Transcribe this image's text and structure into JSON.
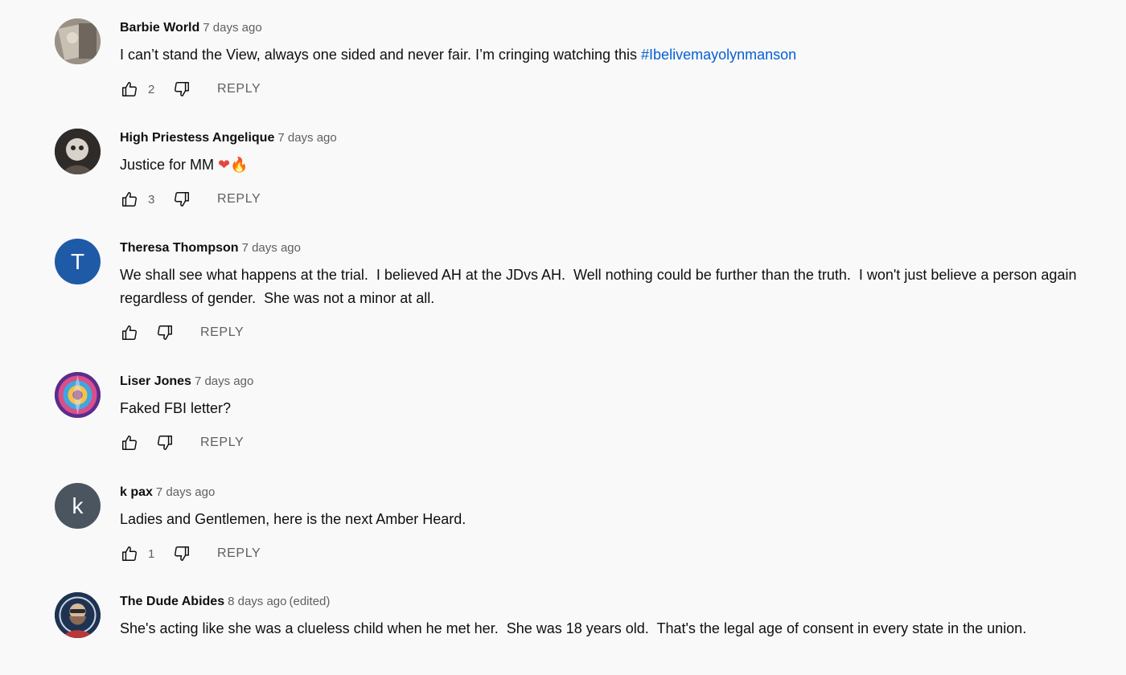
{
  "labels": {
    "reply": "REPLY"
  },
  "comments": [
    {
      "author": "Barbie World",
      "time": "7 days ago",
      "edited": "",
      "text_before": "I can’t stand the View, always one sided and never fair. I’m cringing watching this ",
      "hashtag": "#Ibelivemayolynmanson",
      "likes": "2"
    },
    {
      "author": "High Priestess Angelique",
      "time": "7 days ago",
      "edited": "",
      "text_before": "Justice for MM ",
      "emoji_heart": "❤",
      "emoji_fire": "🔥",
      "likes": "3"
    },
    {
      "author": "Theresa Thompson",
      "avatar_letter": "T",
      "time": "7 days ago",
      "edited": "",
      "text_before": "We shall see what happens at the trial.  I believed AH at the JDvs AH.  Well nothing could be further than the truth.  I won't just believe a person again regardless of gender.  She was not a minor at all.",
      "likes": ""
    },
    {
      "author": "Liser Jones",
      "time": "7 days ago",
      "edited": "",
      "text_before": "Faked FBI letter?",
      "likes": ""
    },
    {
      "author": "k pax",
      "avatar_letter": "k",
      "time": "7 days ago",
      "edited": "",
      "text_before": "Ladies and Gentlemen, here is the next Amber Heard.",
      "likes": "1"
    },
    {
      "author": "The Dude Abides",
      "time": "8 days ago",
      "edited": "(edited)",
      "text_before": "She's acting like she was a clueless child when he met her.  She was 18 years old.  That's the legal age of consent in every state in the union.",
      "likes": ""
    }
  ],
  "colors": {
    "background": "#f9f9f9",
    "hashtag": "#065fd4",
    "avatar_theresa": "#1f5aa6",
    "avatar_kpax": "#4a5560",
    "meta_text": "#606060"
  },
  "icons": {
    "like": "thumbs-up-icon",
    "dislike": "thumbs-down-icon"
  }
}
